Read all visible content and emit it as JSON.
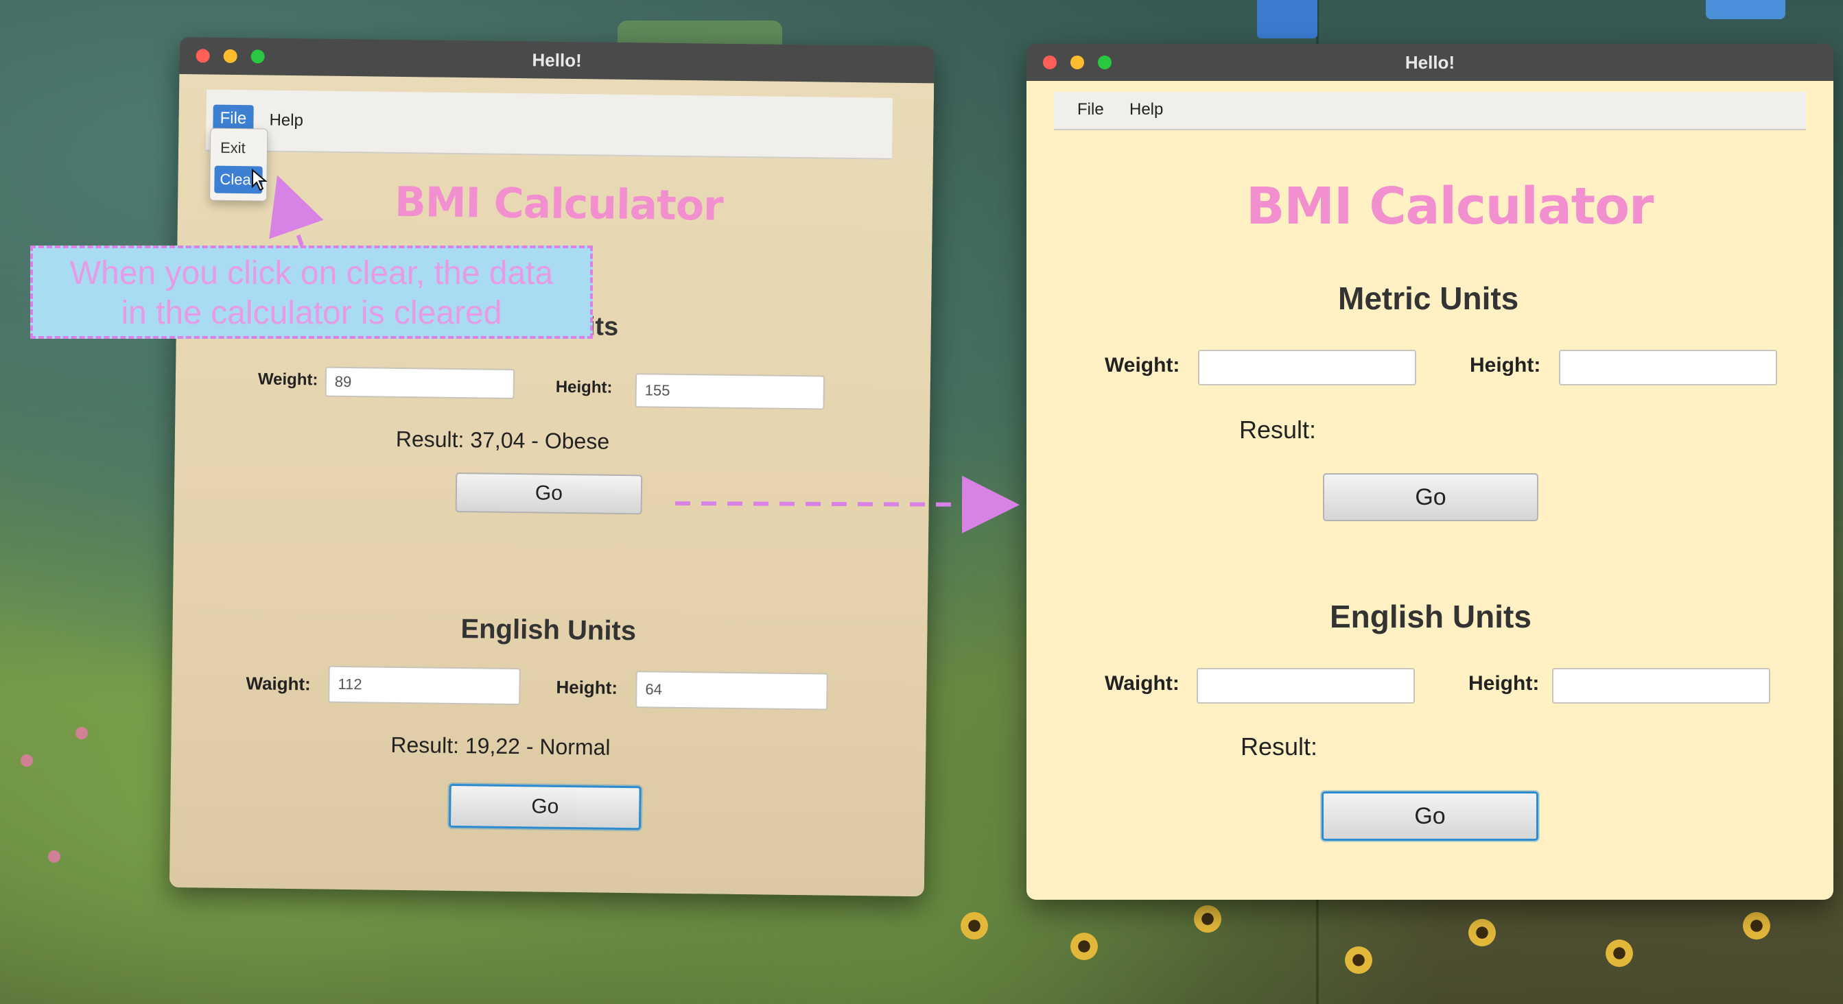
{
  "left_window": {
    "title": "Hello!",
    "menu": {
      "file": "File",
      "help": "Help"
    },
    "dropdown": {
      "items": [
        "Exit",
        "Clear"
      ]
    },
    "app_title": "BMI Calculator",
    "metric": {
      "section_title_fragment": "its",
      "weight_label": "Weight:",
      "weight_value": "89",
      "height_label": "Height:",
      "height_value": "155",
      "result": "Result: 37,04 - Obese",
      "go": "Go"
    },
    "english": {
      "section_title": "English Units",
      "weight_label": "Waight:",
      "weight_value": "112",
      "height_label": "Height:",
      "height_value": "64",
      "result": "Result: 19,22 - Normal",
      "go": "Go"
    }
  },
  "right_window": {
    "title": "Hello!",
    "menu": {
      "file": "File",
      "help": "Help"
    },
    "app_title": "BMI Calculator",
    "metric": {
      "section_title": "Metric Units",
      "weight_label": "Weight:",
      "weight_value": "",
      "height_label": "Height:",
      "height_value": "",
      "result": "Result:",
      "go": "Go"
    },
    "english": {
      "section_title": "English Units",
      "weight_label": "Waight:",
      "weight_value": "",
      "height_label": "Height:",
      "height_value": "",
      "result": "Result:",
      "go": "Go"
    }
  },
  "annotation": {
    "text_line1": "When you click on clear, the data",
    "text_line2": "in the calculator is cleared",
    "color": "#d982e6"
  }
}
